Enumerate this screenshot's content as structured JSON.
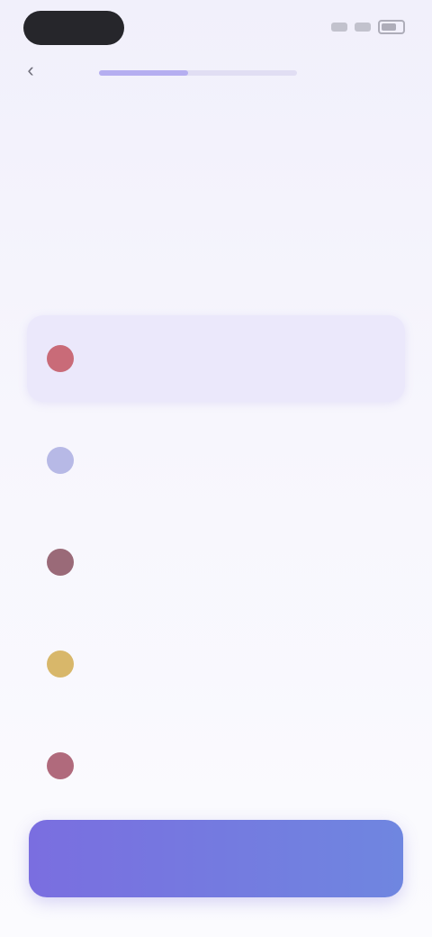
{
  "status_bar": {
    "time": "",
    "icons": [
      "signal-icon",
      "wifi-icon",
      "battery-icon"
    ]
  },
  "header": {
    "back_icon": "chevron-left-icon",
    "progress": 0.45
  },
  "question": {
    "line_a_lead": "",
    "line_a_accent": "",
    "line_b_accent": "",
    "line_b_rest": "",
    "line_c": ""
  },
  "subtitle": "",
  "options": [
    {
      "label": "",
      "icon": "condition-icon",
      "color": "#c96b78",
      "selected": true
    },
    {
      "label": "",
      "icon": "condition-icon",
      "color": "#b7b9e6",
      "selected": false
    },
    {
      "label": "",
      "icon": "condition-icon",
      "color": "#9a6a78",
      "selected": false
    },
    {
      "label": "",
      "icon": "condition-icon",
      "color": "#d8b76a",
      "selected": false
    },
    {
      "label": "",
      "icon": "condition-icon",
      "color": "#b06a7c",
      "selected": false
    }
  ],
  "cta": {
    "label": ""
  },
  "colors": {
    "accent": "#7a72dc",
    "button_gradient_start": "#7a6ee0",
    "button_gradient_end": "#6f86e0",
    "selected_bg": "#ebe8fb"
  }
}
